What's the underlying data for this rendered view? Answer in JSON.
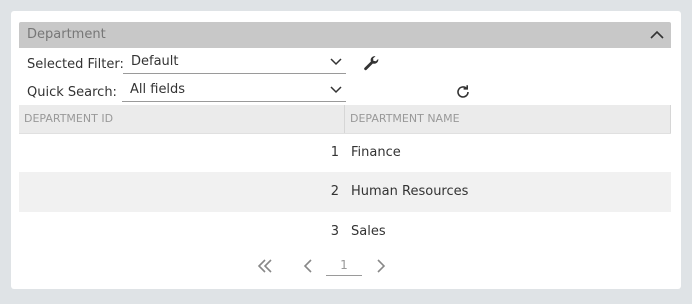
{
  "panel": {
    "title": "Department"
  },
  "filter": {
    "label": "Selected Filter:",
    "value": "Default"
  },
  "search": {
    "label": "Quick Search:",
    "scope": "All fields",
    "value": ""
  },
  "grid": {
    "columns": [
      "DEPARTMENT ID",
      "DEPARTMENT NAME"
    ],
    "rows": [
      {
        "id": "1",
        "name": "Finance"
      },
      {
        "id": "2",
        "name": "Human Resources"
      },
      {
        "id": "3",
        "name": "Sales"
      }
    ]
  },
  "pager": {
    "page": "1"
  },
  "icons": {
    "collapse": "chevron-up-icon",
    "filter_settings": "wrench-icon",
    "refresh": "refresh-icon",
    "first_page": "double-chevron-left-icon",
    "prev_page": "chevron-left-icon",
    "next_page": "chevron-right-icon"
  },
  "colors": {
    "header": "#c8c8c8",
    "row_alt": "#f1f1f1",
    "background": "#dfe3e6"
  }
}
